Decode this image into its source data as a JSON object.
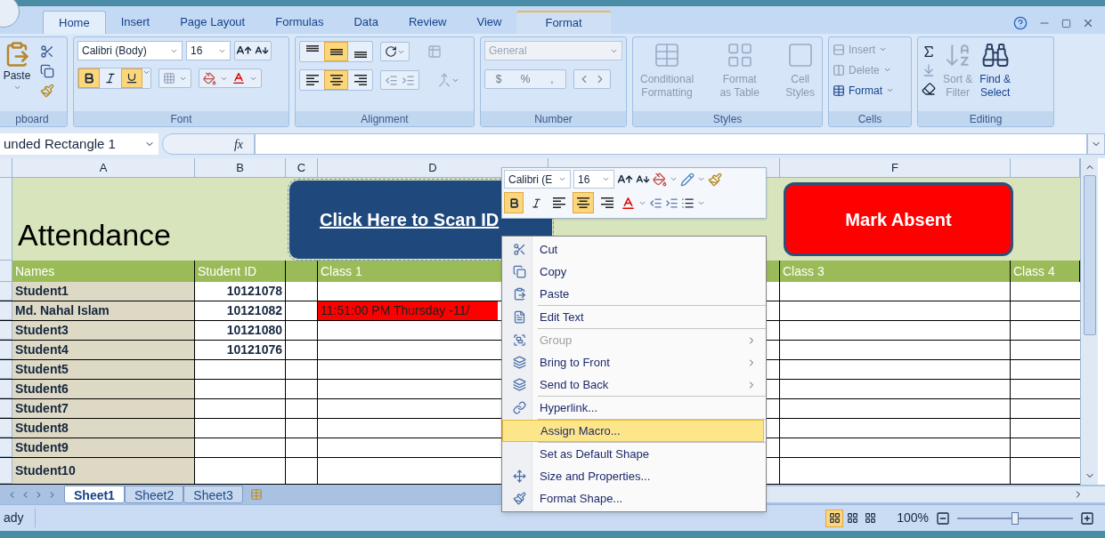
{
  "tabs": [
    {
      "label": "Home",
      "selected": true,
      "kind": "standard"
    },
    {
      "label": "Insert",
      "selected": false,
      "kind": "standard"
    },
    {
      "label": "Page Layout",
      "selected": false,
      "kind": "standard"
    },
    {
      "label": "Formulas",
      "selected": false,
      "kind": "standard"
    },
    {
      "label": "Data",
      "selected": false,
      "kind": "standard"
    },
    {
      "label": "Review",
      "selected": false,
      "kind": "standard"
    },
    {
      "label": "View",
      "selected": false,
      "kind": "standard"
    },
    {
      "label": "Format",
      "selected": false,
      "kind": "contextual"
    }
  ],
  "ribbon": {
    "clipboard": {
      "title": "pboard",
      "paste": "Paste"
    },
    "font": {
      "title": "Font",
      "font_name": "Calibri (Body)",
      "font_size": "16",
      "bold": true,
      "italic": false,
      "underline": true
    },
    "alignment": {
      "title": "Alignment",
      "vertical": [
        {
          "selected": false
        },
        {
          "selected": true
        },
        {
          "selected": false
        }
      ],
      "horizontal": [
        {
          "selected": false
        },
        {
          "selected": true
        },
        {
          "selected": false
        }
      ]
    },
    "number": {
      "title": "Number",
      "format": "General",
      "symbols": [
        "$",
        "%",
        ","
      ],
      "disabled": true
    },
    "styles": {
      "title": "Styles",
      "buttons": [
        {
          "lines": [
            "Conditional",
            "Formatting"
          ],
          "disabled": true
        },
        {
          "lines": [
            "Format",
            "as Table"
          ],
          "disabled": true
        },
        {
          "lines": [
            "Cell",
            "Styles"
          ],
          "disabled": true
        }
      ]
    },
    "cells": {
      "title": "Cells",
      "buttons": [
        {
          "label": "Insert",
          "disabled": true
        },
        {
          "label": "Delete",
          "disabled": true
        },
        {
          "label": "Format",
          "disabled": false
        }
      ]
    },
    "editing": {
      "title": "Editing",
      "buttons": [
        {
          "lines": [
            "Sort &",
            "Filter"
          ],
          "disabled": true
        },
        {
          "lines": [
            "Find &",
            "Select"
          ],
          "disabled": false
        }
      ]
    }
  },
  "formula_bar": {
    "name_box": "unded Rectangle 1",
    "function_label": "fx"
  },
  "sheet": {
    "columns": [
      {
        "label": "A"
      },
      {
        "label": "B"
      },
      {
        "label": "C"
      },
      {
        "label": "D"
      },
      {},
      {
        "label": "F"
      },
      {}
    ],
    "title": "Attendance",
    "headers": {
      "names": "Names",
      "student_id": "Student ID",
      "class_1": "Class 1",
      "class_3": "Class 3",
      "class_4": "Class 4"
    },
    "rows": [
      {
        "name": "Student1",
        "id": "10121078"
      },
      {
        "name": "Md. Nahal Islam",
        "id": "10121082",
        "class_1": {
          "text": "11:51:00 PM Thursday -11/",
          "color": "#ff0000"
        }
      },
      {
        "name": "Student3",
        "id": "10121080"
      },
      {
        "name": "Student4",
        "id": "10121076"
      },
      {
        "name": "Student5"
      },
      {
        "name": "Student6"
      },
      {
        "name": "Student7"
      },
      {
        "name": "Student8"
      },
      {
        "name": "Student9"
      },
      {
        "name": "Student10"
      }
    ]
  },
  "shapes": {
    "scan_button": {
      "label": "Click Here to Scan ID",
      "selected": true
    },
    "absent_button": {
      "label": "Mark Absent",
      "selected": false
    }
  },
  "mini_toolbar": {
    "font_name": "Calibri (E",
    "font_size": "16",
    "bold": true,
    "italic": false,
    "align": [
      {
        "selected": false
      },
      {
        "selected": true
      },
      {
        "selected": false
      }
    ]
  },
  "context_menu": {
    "sections": [
      [
        {
          "label": "Cut",
          "disabled": false,
          "submenu": false,
          "selected": false
        },
        {
          "label": "Copy",
          "disabled": false,
          "submenu": false,
          "selected": false
        },
        {
          "label": "Paste",
          "disabled": false,
          "submenu": false,
          "selected": false
        }
      ],
      [
        {
          "label": "Edit Text",
          "disabled": false,
          "submenu": false,
          "selected": false
        }
      ],
      [
        {
          "label": "Group",
          "disabled": true,
          "submenu": true,
          "selected": false
        },
        {
          "label": "Bring to Front",
          "disabled": false,
          "submenu": true,
          "selected": false
        },
        {
          "label": "Send to Back",
          "disabled": false,
          "submenu": true,
          "selected": false
        }
      ],
      [
        {
          "label": "Hyperlink...",
          "disabled": false,
          "submenu": false,
          "selected": false
        }
      ],
      [
        {
          "label": "Assign Macro...",
          "disabled": false,
          "submenu": false,
          "selected": true
        }
      ],
      [
        {
          "label": "Set as Default Shape",
          "disabled": false,
          "submenu": false,
          "selected": false
        },
        {
          "label": "Size and Properties...",
          "disabled": false,
          "submenu": false,
          "selected": false
        },
        {
          "label": "Format Shape...",
          "disabled": false,
          "submenu": false,
          "selected": false
        }
      ]
    ]
  },
  "sheet_tabs": [
    {
      "label": "Sheet1",
      "selected": true
    },
    {
      "label": "Sheet2",
      "selected": false
    },
    {
      "label": "Sheet3",
      "selected": false
    }
  ],
  "status_bar": {
    "status": "ady",
    "views": [
      {
        "selected": true
      },
      {
        "selected": false
      },
      {
        "selected": false
      }
    ],
    "zoom": "100%",
    "zoom_level": {
      "level": 0.5
    }
  }
}
